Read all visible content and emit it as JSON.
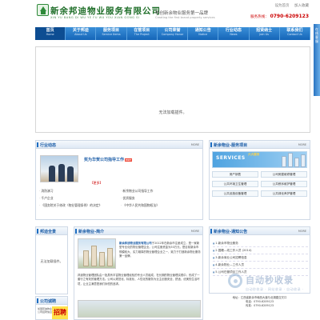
{
  "header": {
    "company_name": "新余邦迪物业服务有限公司",
    "company_pinyin": "XIN YU BANG DI WU YE FU WU YOU XIAN GONG SI",
    "slogan": "争创新余物业服务第一品牌",
    "slogan_en": "Creating the first brand property services",
    "top_links": [
      "设为首页",
      "加入收藏"
    ],
    "hotline_label": "服务热线：",
    "hotline": "0790-6209123"
  },
  "nav": [
    {
      "cn": "首页",
      "en": "Home"
    },
    {
      "cn": "关于邦迪",
      "en": "About Us"
    },
    {
      "cn": "服务项目",
      "en": "Service Items"
    },
    {
      "cn": "在管项目",
      "en": "The Project"
    },
    {
      "cn": "公司荣誉",
      "en": "Company Honor"
    },
    {
      "cn": "通知公告",
      "en": "Notice"
    },
    {
      "cn": "行业动态",
      "en": "News"
    },
    {
      "cn": "招贤纳士",
      "en": "Join Us"
    },
    {
      "cn": "联系我们",
      "en": "Contact Us"
    }
  ],
  "banner": {
    "message": "无法加载插件。"
  },
  "side_strip": {
    "text": "在线客服"
  },
  "industry": {
    "title": "行业动态",
    "more": "MORE",
    "headline": "奖为华贺公司指导工作",
    "hot": "HOT",
    "detail": "【更多】",
    "items": [
      "消防演习",
      "新余物业公司指导工作",
      "千户企业",
      "优质服务",
      "《国务院关于修改〈物业管理条例〉的决定》",
      "《中华人民共和国物权法》"
    ]
  },
  "service": {
    "title": "新余物业-服务项目",
    "more": "MORE",
    "banner_en": "SERVICES",
    "banner_cn": "六大服务",
    "items": [
      "房产销售",
      "公司房屋维修管理",
      "公共环境卫生管理",
      "公共秩序维护管理",
      "公共设施设备管理",
      "公共绿化养护管理"
    ]
  },
  "flash": {
    "title": "邦迪全景",
    "message": "无法加载插件。"
  },
  "intro": {
    "title": "新余物业-简介",
    "more": "MORE",
    "company": "新余邦迪物业服务有限公司",
    "paragraph1": "于2012年在新余市注册成立，是一家新型专业化的物业管理企业。公司注册资金为50万元，是目前新余市规模较大、实力雄厚的物业管理企业之一，致力于打造新余物业服务第一品牌。",
    "paragraph2": "邦迪物业管理团队由一批具有丰富物业管理经验的专业人员组成，在长期的物业管理实践中，形成了一套行之有效的管理方法。公司以规范化、标准化、人性化的服务为业主创造安全、舒适、优美的生活环境，让业主满意是我们永恒的追求。"
  },
  "notice": {
    "title": "新余物业-通知公告",
    "more": "MORE",
    "items": [
      "1.新余市物业服务",
      "2.国籍—线工作人员 (2014)",
      "3.新余商业公司招聘信息",
      "4.新余物业—工作人员",
      "5.公司在管项目工作人员"
    ]
  },
  "honor": {
    "title": "公司诚聘",
    "more": "MORE",
    "image_text": "招聘",
    "text": "加盟邦迪物业公司招聘信息"
  },
  "footer": {
    "address": "地址：江西省新余市赣西大道与北湖路交叉口",
    "phone": "电话：0790-6209123",
    "fax": "传真：0790-6209123"
  },
  "watermark": {
    "text": "自动秒收录",
    "sub": "自动秒收录 · 网站收录 · 自动收录 ·"
  }
}
